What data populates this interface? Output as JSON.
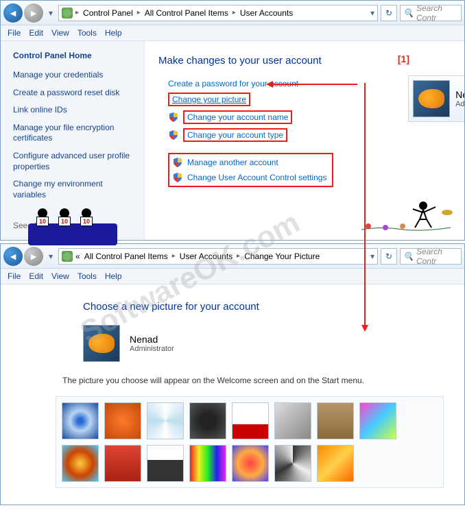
{
  "window1": {
    "breadcrumbs": {
      "prefix": "",
      "items": [
        "Control Panel",
        "All Control Panel Items",
        "User Accounts"
      ]
    },
    "search_placeholder": "Search Contr",
    "menu": [
      "File",
      "Edit",
      "View",
      "Tools",
      "Help"
    ],
    "sidebar": {
      "home": "Control Panel Home",
      "links": [
        "Manage your credentials",
        "Create a password reset disk",
        "Link online IDs",
        "Manage your file encryption certificates",
        "Configure advanced user profile properties",
        "Change my environment variables"
      ],
      "see_also": "See als"
    },
    "main": {
      "heading": "Make changes to your user account",
      "tasks_plain": [
        "Create a password for your account"
      ],
      "tasks_boxed": [
        "Change your picture",
        "Change your account name",
        "Change your account type"
      ],
      "tasks_group": [
        "Manage another account",
        "Change User Account Control settings"
      ],
      "annotation": "[1]"
    },
    "user": {
      "name": "Ne",
      "role": "Ad"
    },
    "judges": {
      "scores": [
        "10",
        "10",
        "10"
      ]
    }
  },
  "window2": {
    "breadcrumbs": {
      "prefix": "«",
      "items": [
        "All Control Panel Items",
        "User Accounts",
        "Change Your Picture"
      ]
    },
    "search_placeholder": "Search Contr",
    "menu": [
      "File",
      "Edit",
      "View",
      "Tools",
      "Help"
    ],
    "main": {
      "heading": "Choose a new picture for your account",
      "user": {
        "name": "Nenad",
        "role": "Administrator"
      },
      "description": "The picture you choose will appear on the Welcome screen and on the Start menu."
    }
  },
  "watermark": "SoftwareOK.com"
}
